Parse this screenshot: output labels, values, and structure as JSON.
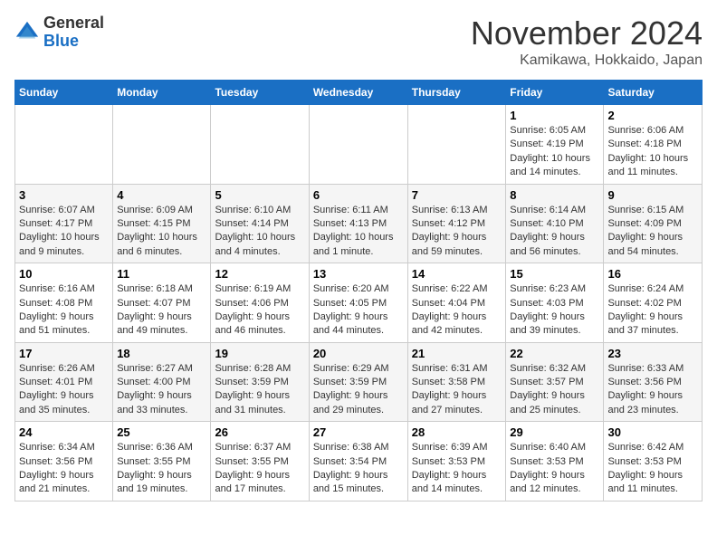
{
  "logo": {
    "general": "General",
    "blue": "Blue"
  },
  "title": {
    "month_year": "November 2024",
    "location": "Kamikawa, Hokkaido, Japan"
  },
  "days_of_week": [
    "Sunday",
    "Monday",
    "Tuesday",
    "Wednesday",
    "Thursday",
    "Friday",
    "Saturday"
  ],
  "weeks": [
    [
      {
        "day": "",
        "info": ""
      },
      {
        "day": "",
        "info": ""
      },
      {
        "day": "",
        "info": ""
      },
      {
        "day": "",
        "info": ""
      },
      {
        "day": "",
        "info": ""
      },
      {
        "day": "1",
        "info": "Sunrise: 6:05 AM\nSunset: 4:19 PM\nDaylight: 10 hours and 14 minutes."
      },
      {
        "day": "2",
        "info": "Sunrise: 6:06 AM\nSunset: 4:18 PM\nDaylight: 10 hours and 11 minutes."
      }
    ],
    [
      {
        "day": "3",
        "info": "Sunrise: 6:07 AM\nSunset: 4:17 PM\nDaylight: 10 hours and 9 minutes."
      },
      {
        "day": "4",
        "info": "Sunrise: 6:09 AM\nSunset: 4:15 PM\nDaylight: 10 hours and 6 minutes."
      },
      {
        "day": "5",
        "info": "Sunrise: 6:10 AM\nSunset: 4:14 PM\nDaylight: 10 hours and 4 minutes."
      },
      {
        "day": "6",
        "info": "Sunrise: 6:11 AM\nSunset: 4:13 PM\nDaylight: 10 hours and 1 minute."
      },
      {
        "day": "7",
        "info": "Sunrise: 6:13 AM\nSunset: 4:12 PM\nDaylight: 9 hours and 59 minutes."
      },
      {
        "day": "8",
        "info": "Sunrise: 6:14 AM\nSunset: 4:10 PM\nDaylight: 9 hours and 56 minutes."
      },
      {
        "day": "9",
        "info": "Sunrise: 6:15 AM\nSunset: 4:09 PM\nDaylight: 9 hours and 54 minutes."
      }
    ],
    [
      {
        "day": "10",
        "info": "Sunrise: 6:16 AM\nSunset: 4:08 PM\nDaylight: 9 hours and 51 minutes."
      },
      {
        "day": "11",
        "info": "Sunrise: 6:18 AM\nSunset: 4:07 PM\nDaylight: 9 hours and 49 minutes."
      },
      {
        "day": "12",
        "info": "Sunrise: 6:19 AM\nSunset: 4:06 PM\nDaylight: 9 hours and 46 minutes."
      },
      {
        "day": "13",
        "info": "Sunrise: 6:20 AM\nSunset: 4:05 PM\nDaylight: 9 hours and 44 minutes."
      },
      {
        "day": "14",
        "info": "Sunrise: 6:22 AM\nSunset: 4:04 PM\nDaylight: 9 hours and 42 minutes."
      },
      {
        "day": "15",
        "info": "Sunrise: 6:23 AM\nSunset: 4:03 PM\nDaylight: 9 hours and 39 minutes."
      },
      {
        "day": "16",
        "info": "Sunrise: 6:24 AM\nSunset: 4:02 PM\nDaylight: 9 hours and 37 minutes."
      }
    ],
    [
      {
        "day": "17",
        "info": "Sunrise: 6:26 AM\nSunset: 4:01 PM\nDaylight: 9 hours and 35 minutes."
      },
      {
        "day": "18",
        "info": "Sunrise: 6:27 AM\nSunset: 4:00 PM\nDaylight: 9 hours and 33 minutes."
      },
      {
        "day": "19",
        "info": "Sunrise: 6:28 AM\nSunset: 3:59 PM\nDaylight: 9 hours and 31 minutes."
      },
      {
        "day": "20",
        "info": "Sunrise: 6:29 AM\nSunset: 3:59 PM\nDaylight: 9 hours and 29 minutes."
      },
      {
        "day": "21",
        "info": "Sunrise: 6:31 AM\nSunset: 3:58 PM\nDaylight: 9 hours and 27 minutes."
      },
      {
        "day": "22",
        "info": "Sunrise: 6:32 AM\nSunset: 3:57 PM\nDaylight: 9 hours and 25 minutes."
      },
      {
        "day": "23",
        "info": "Sunrise: 6:33 AM\nSunset: 3:56 PM\nDaylight: 9 hours and 23 minutes."
      }
    ],
    [
      {
        "day": "24",
        "info": "Sunrise: 6:34 AM\nSunset: 3:56 PM\nDaylight: 9 hours and 21 minutes."
      },
      {
        "day": "25",
        "info": "Sunrise: 6:36 AM\nSunset: 3:55 PM\nDaylight: 9 hours and 19 minutes."
      },
      {
        "day": "26",
        "info": "Sunrise: 6:37 AM\nSunset: 3:55 PM\nDaylight: 9 hours and 17 minutes."
      },
      {
        "day": "27",
        "info": "Sunrise: 6:38 AM\nSunset: 3:54 PM\nDaylight: 9 hours and 15 minutes."
      },
      {
        "day": "28",
        "info": "Sunrise: 6:39 AM\nSunset: 3:53 PM\nDaylight: 9 hours and 14 minutes."
      },
      {
        "day": "29",
        "info": "Sunrise: 6:40 AM\nSunset: 3:53 PM\nDaylight: 9 hours and 12 minutes."
      },
      {
        "day": "30",
        "info": "Sunrise: 6:42 AM\nSunset: 3:53 PM\nDaylight: 9 hours and 11 minutes."
      }
    ]
  ]
}
